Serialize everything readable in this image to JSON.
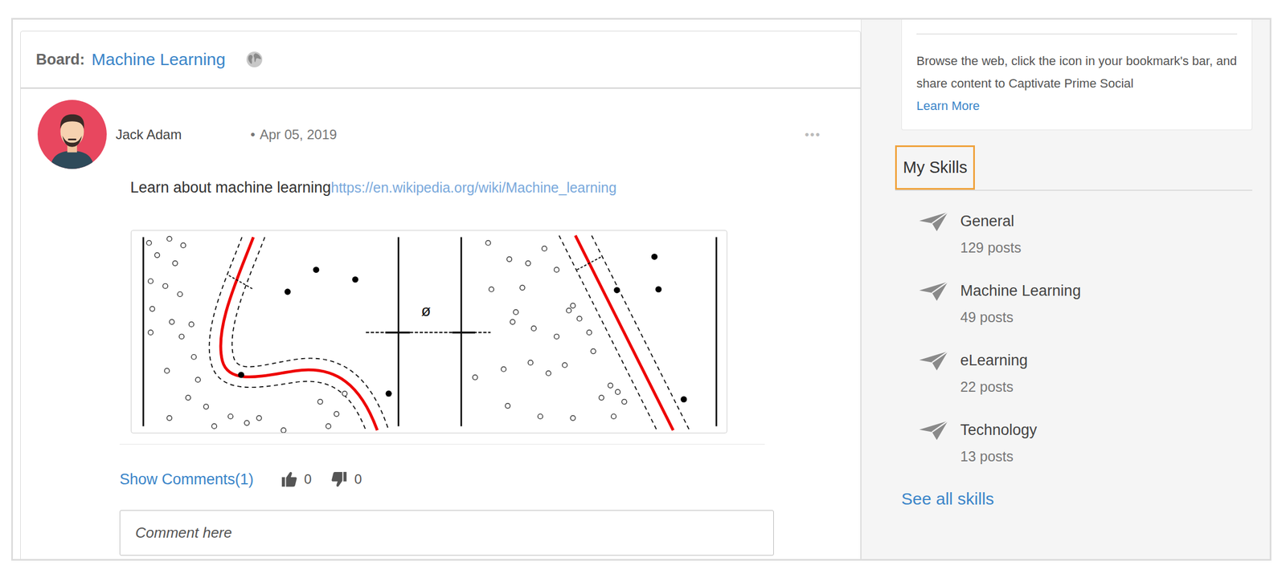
{
  "board": {
    "label": "Board:",
    "name": "Machine Learning"
  },
  "post": {
    "author": "Jack Adam",
    "separator": "•",
    "date": "Apr 05, 2019",
    "menu": "•••",
    "text": "Learn about machine learning",
    "link": "https://en.wikipedia.org/wiki/Machine_learning",
    "image_label": "ø",
    "comments": "Show Comments(1)",
    "likes": "0",
    "dislikes": "0",
    "comment_placeholder": "Comment here"
  },
  "bookmarklet": {
    "text": "Browse the web, click the icon in your bookmark's bar, and share content to Captivate Prime Social",
    "link": "Learn More"
  },
  "skills": {
    "title": "My Skills",
    "highlighted": true,
    "items": [
      {
        "name": "General",
        "count": "129 posts"
      },
      {
        "name": "Machine Learning",
        "count": "49 posts"
      },
      {
        "name": "eLearning",
        "count": "22 posts"
      },
      {
        "name": "Technology",
        "count": "13 posts"
      }
    ],
    "more": "See all skills"
  }
}
